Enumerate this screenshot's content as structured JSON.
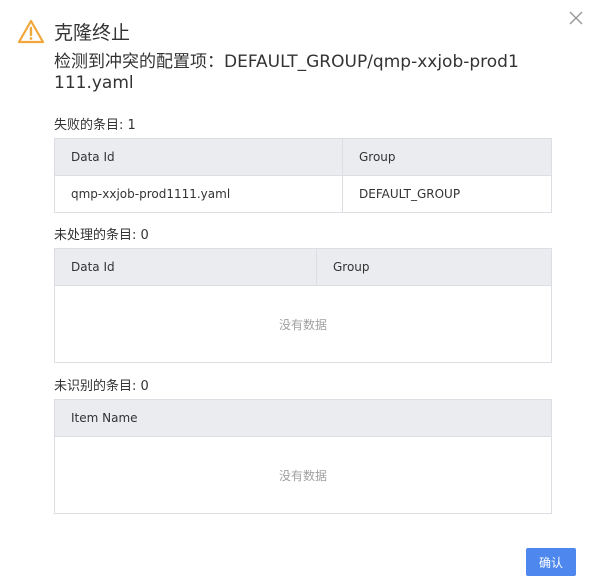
{
  "dialog": {
    "title": "克隆终止",
    "subtitle": "检测到冲突的配置项：DEFAULT_GROUP/qmp-xxjob-prod1111.yaml",
    "confirm_label": "确认",
    "close_icon": "close-icon",
    "warning_icon": "warning-icon",
    "warning_color": "#f1a73b"
  },
  "failed": {
    "label": "失败的条目: 1",
    "columns": [
      "Data Id",
      "Group"
    ],
    "rows": [
      {
        "data_id": "qmp-xxjob-prod1111.yaml",
        "group": "DEFAULT_GROUP"
      }
    ]
  },
  "unprocessed": {
    "label": "未处理的条目: 0",
    "columns": [
      "Data Id",
      "Group"
    ],
    "empty_text": "没有数据"
  },
  "unrecognized": {
    "label": "未识别的条目: 0",
    "columns": [
      "Item Name"
    ],
    "empty_text": "没有数据"
  }
}
